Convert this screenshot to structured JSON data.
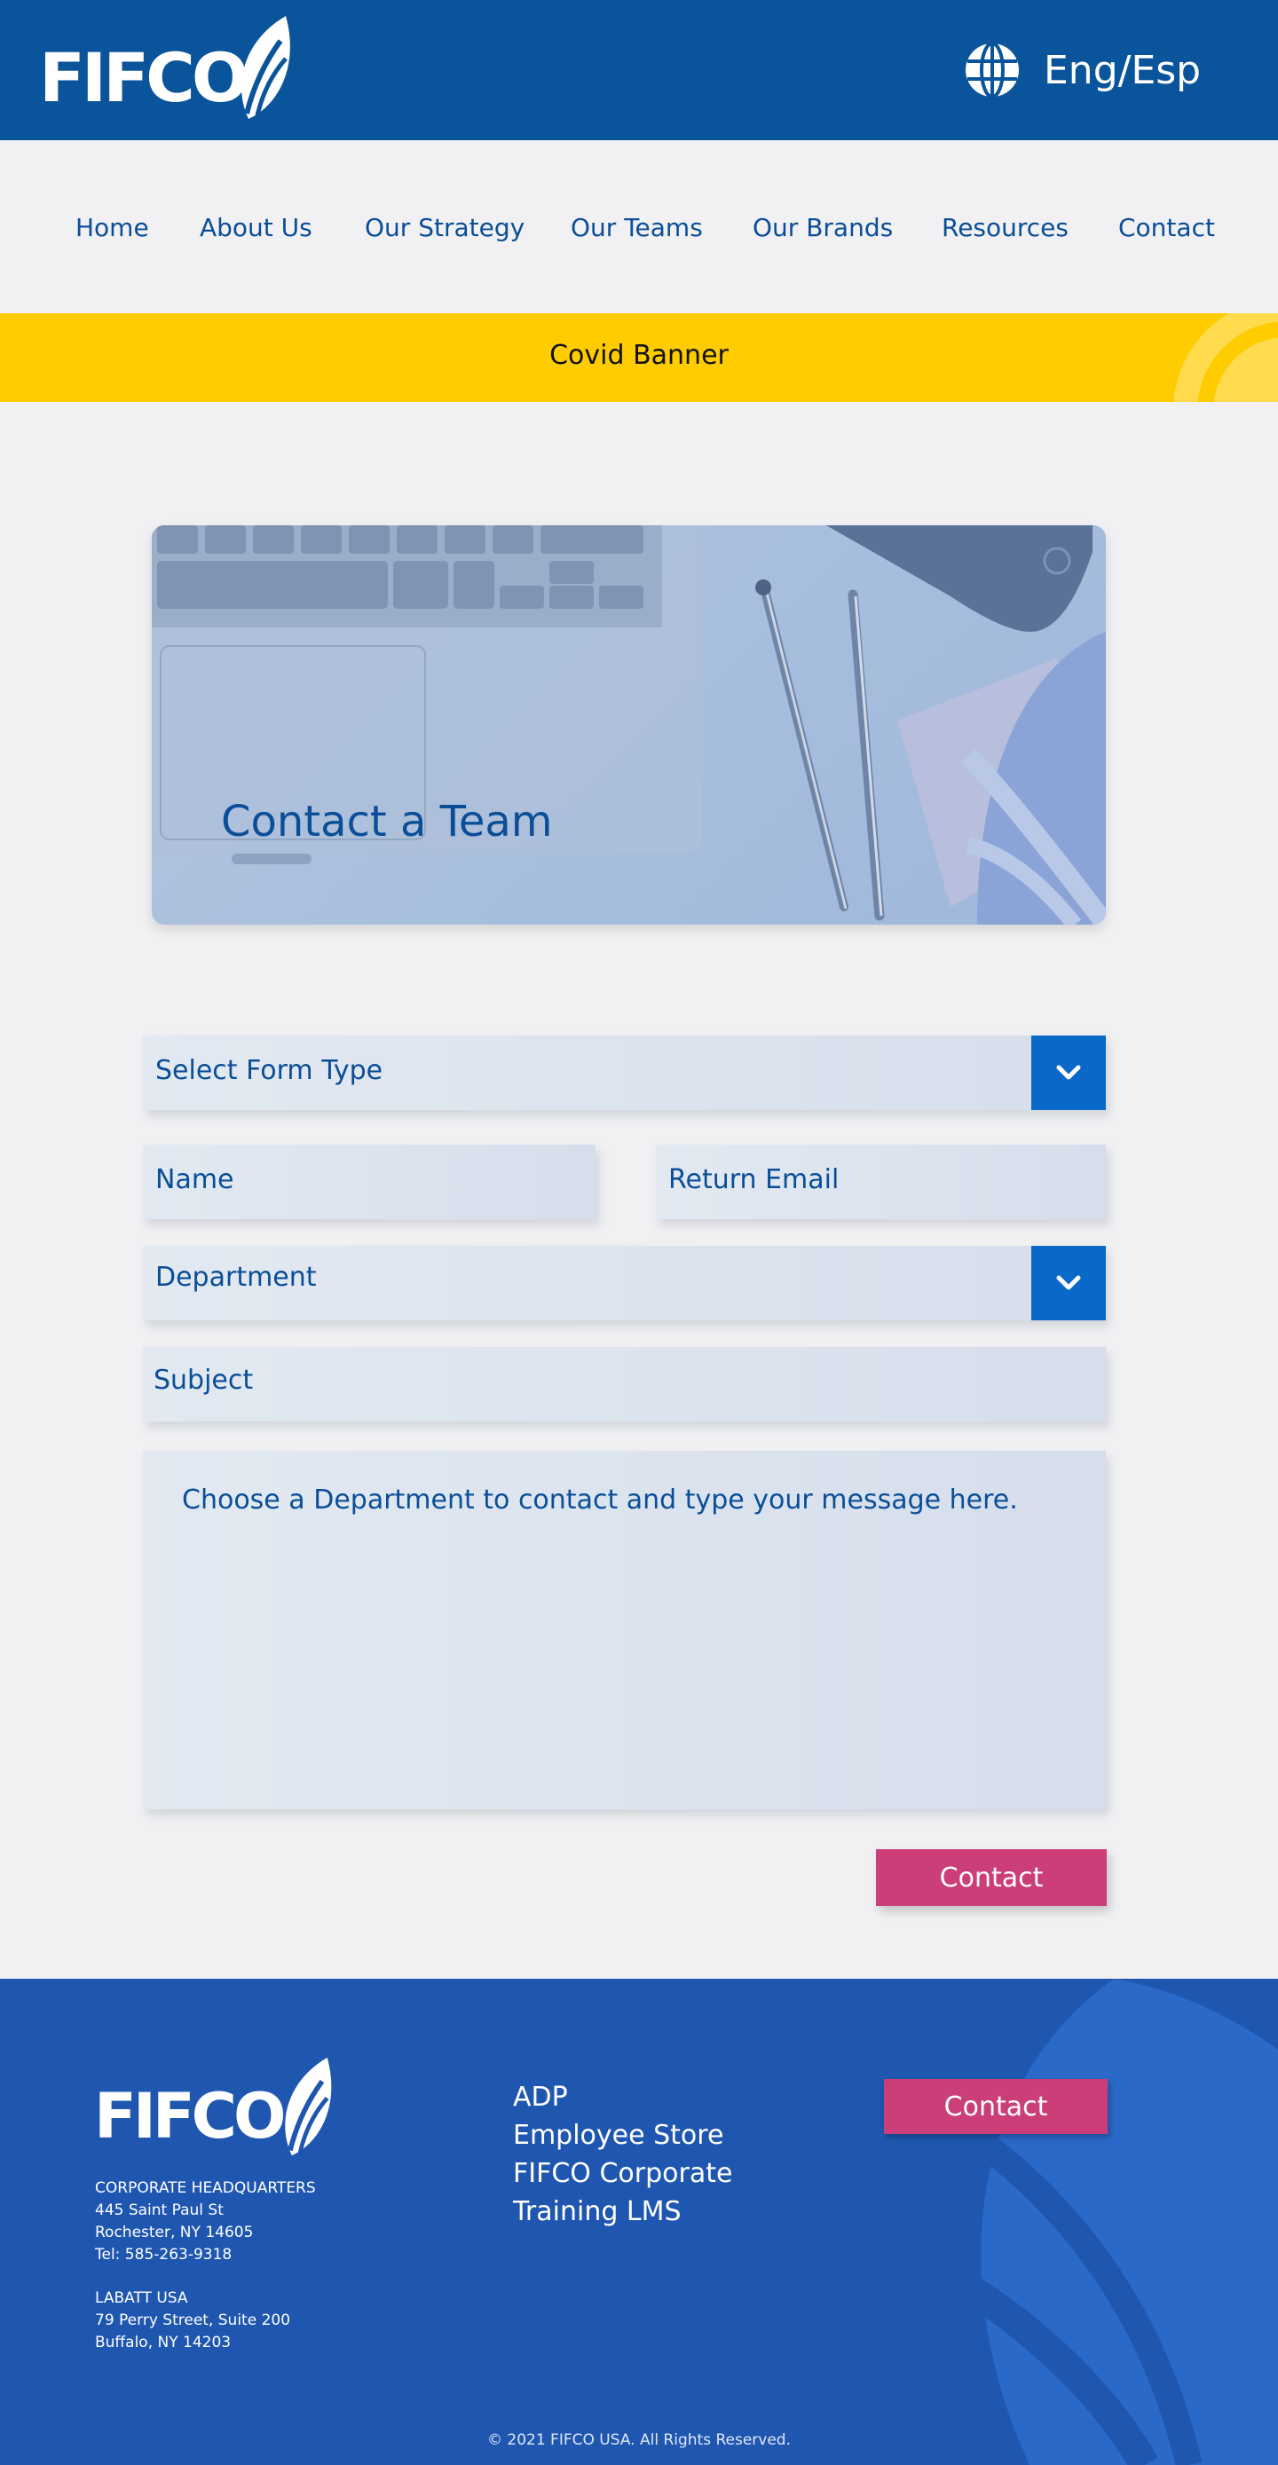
{
  "header": {
    "logo_text": "FIFCO",
    "language_label": "Eng/Esp"
  },
  "nav": {
    "items": [
      {
        "label": "Home"
      },
      {
        "label": "About Us"
      },
      {
        "label": "Our Strategy"
      },
      {
        "label": "Our Teams"
      },
      {
        "label": "Our Brands"
      },
      {
        "label": "Resources"
      },
      {
        "label": "Contact"
      }
    ]
  },
  "banner": {
    "text": "Covid Banner"
  },
  "hero": {
    "title": "Contact a Team"
  },
  "form": {
    "form_type_placeholder": "Select Form Type",
    "name_placeholder": "Name",
    "email_placeholder": "Return Email",
    "department_placeholder": "Department",
    "subject_placeholder": "Subject",
    "message_placeholder": "Choose a Department to contact and type your message here.",
    "submit_label": "Contact"
  },
  "footer": {
    "logo_text": "FIFCO",
    "hq": {
      "title": "CORPORATE HEADQUARTERS",
      "street": "445 Saint Paul St",
      "city": "Rochester, NY 14605",
      "phone": "Tel: 585-263-9318"
    },
    "labatt": {
      "title": "LABATT USA",
      "street": "79 Perry Street, Suite 200",
      "city": "Buffalo, NY 14203"
    },
    "links": [
      {
        "label": "ADP"
      },
      {
        "label": "Employee Store"
      },
      {
        "label": "FIFCO Corporate"
      },
      {
        "label": "Training LMS"
      }
    ],
    "contact_label": "Contact",
    "copyright": "© 2021 FIFCO USA. All Rights Reserved."
  },
  "colors": {
    "header_bg": "#0a549c",
    "banner_bg": "#ffcc00",
    "accent_pink": "#cc3e7a",
    "dropdown_blue": "#0a68c9",
    "footer_bg": "#1f57b0",
    "text_blue": "#0a4e98"
  },
  "icons": [
    "leaf-logo-icon",
    "globe-icon",
    "chevron-down-icon"
  ]
}
